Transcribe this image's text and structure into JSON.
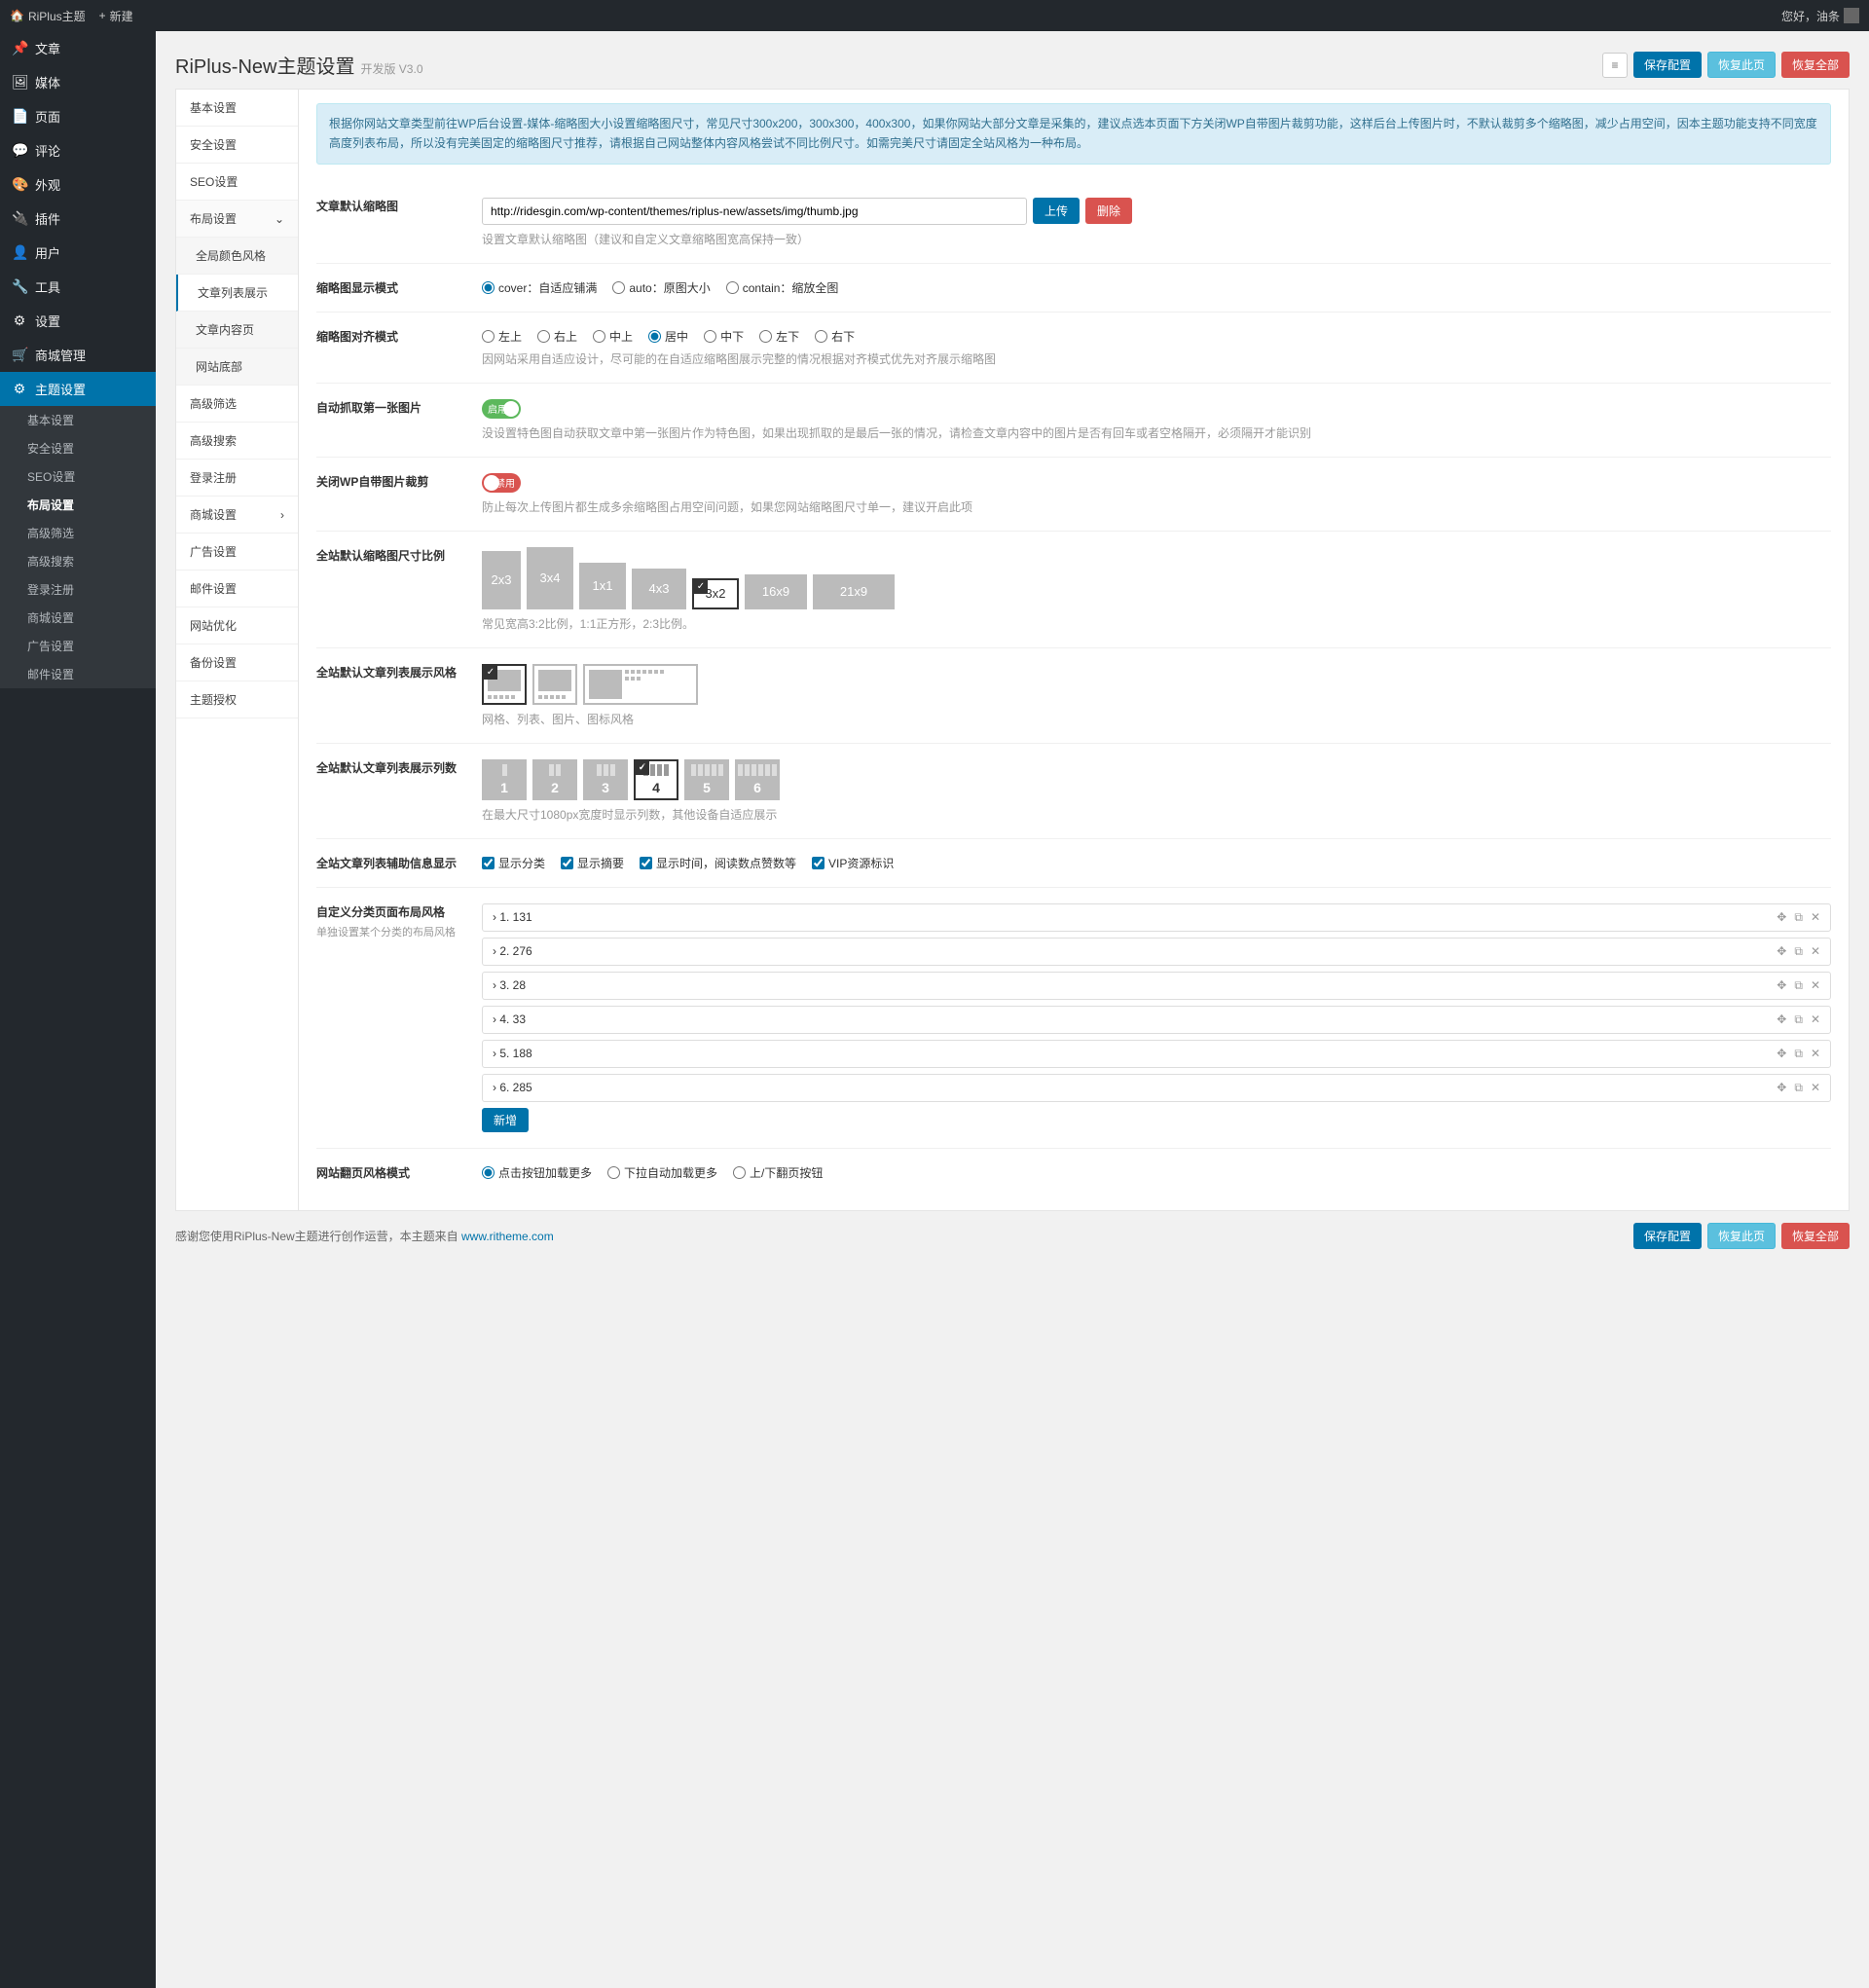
{
  "adminbar": {
    "site": "RiPlus主题",
    "new": "新建",
    "greeting": "您好，油条"
  },
  "sidebar": {
    "items": [
      {
        "icon": "📌",
        "label": "文章"
      },
      {
        "icon": "🖼",
        "label": "媒体"
      },
      {
        "icon": "📄",
        "label": "页面"
      },
      {
        "icon": "💬",
        "label": "评论"
      },
      {
        "icon": "🎨",
        "label": "外观"
      },
      {
        "icon": "🔌",
        "label": "插件"
      },
      {
        "icon": "👤",
        "label": "用户"
      },
      {
        "icon": "🔧",
        "label": "工具"
      },
      {
        "icon": "⚙",
        "label": "设置"
      },
      {
        "icon": "🛒",
        "label": "商城管理"
      },
      {
        "icon": "⚙",
        "label": "主题设置",
        "active": true
      }
    ],
    "sub": [
      "基本设置",
      "安全设置",
      "SEO设置",
      "布局设置",
      "高级筛选",
      "高级搜索",
      "登录注册",
      "商城设置",
      "广告设置",
      "邮件设置"
    ]
  },
  "panel": {
    "title": "RiPlus-New主题设置",
    "version": "开发版 V3.0",
    "save": "保存配置",
    "restore": "恢复此页",
    "restore_all": "恢复全部"
  },
  "tabs": {
    "list": [
      "基本设置",
      "安全设置",
      "SEO设置",
      "布局设置",
      "高级筛选",
      "高级搜索",
      "登录注册",
      "商城设置",
      "广告设置",
      "邮件设置",
      "网站优化",
      "备份设置",
      "主题授权"
    ],
    "layout_sub": [
      "全局颜色风格",
      "文章列表展示",
      "文章内容页",
      "网站底部"
    ]
  },
  "form": {
    "notice": "根据你网站文章类型前往WP后台设置-媒体-缩略图大小设置缩略图尺寸，常见尺寸300x200，300x300，400x300，如果你网站大部分文章是采集的，建议点选本页面下方关闭WP自带图片裁剪功能，这样后台上传图片时，不默认裁剪多个缩略图，减少占用空间，因本主题功能支持不同宽度高度列表布局，所以没有完美固定的缩略图尺寸推荐，请根据自己网站整体内容风格尝试不同比例尺寸。如需完美尺寸请固定全站风格为一种布局。",
    "thumb": {
      "label": "文章默认缩略图",
      "value": "http://ridesgin.com/wp-content/themes/riplus-new/assets/img/thumb.jpg",
      "upload": "上传",
      "delete": "删除",
      "desc": "设置文章默认缩略图（建议和自定义文章缩略图宽高保持一致）"
    },
    "display_mode": {
      "label": "缩略图显示模式",
      "options": [
        "cover：自适应铺满",
        "auto：原图大小",
        "contain：缩放全图"
      ]
    },
    "align_mode": {
      "label": "缩略图对齐模式",
      "options": [
        "左上",
        "右上",
        "中上",
        "居中",
        "中下",
        "左下",
        "右下"
      ],
      "desc": "因网站采用自适应设计，尽可能的在自适应缩略图展示完整的情况根据对齐模式优先对齐展示缩略图"
    },
    "auto_grab": {
      "label": "自动抓取第一张图片",
      "on_text": "启用",
      "desc": "没设置特色图自动获取文章中第一张图片作为特色图，如果出现抓取的是最后一张的情况，请检查文章内容中的图片是否有回车或者空格隔开，必须隔开才能识别"
    },
    "disable_crop": {
      "label": "关闭WP自带图片裁剪",
      "off_text": "禁用",
      "desc": "防止每次上传图片都生成多余缩略图占用空间问题，如果您网站缩略图尺寸单一，建议开启此项"
    },
    "ratio": {
      "label": "全站默认缩略图尺寸比例",
      "options": [
        "2x3",
        "3x4",
        "1x1",
        "4x3",
        "3x2",
        "16x9",
        "21x9"
      ],
      "desc": "常见宽高3:2比例，1:1正方形，2:3比例。"
    },
    "list_style": {
      "label": "全站默认文章列表展示风格",
      "desc": "网格、列表、图片、图标风格"
    },
    "cols": {
      "label": "全站默认文章列表展示列数",
      "options": [
        "1",
        "2",
        "3",
        "4",
        "5",
        "6"
      ],
      "desc": "在最大尺寸1080px宽度时显示列数，其他设备自适应展示"
    },
    "meta": {
      "label": "全站文章列表辅助信息显示",
      "options": [
        "显示分类",
        "显示摘要",
        "显示时间，阅读数点赞数等",
        "VIP资源标识"
      ]
    },
    "cat_layout": {
      "label": "自定义分类页面布局风格",
      "sub": "单独设置某个分类的布局风格",
      "items": [
        "1. 131",
        "2. 276",
        "3. 28",
        "4. 33",
        "5. 188",
        "6. 285"
      ],
      "add": "新增"
    },
    "pager": {
      "label": "网站翻页风格模式",
      "options": [
        "点击按钮加载更多",
        "下拉自动加载更多",
        "上/下翻页按钮"
      ]
    }
  },
  "footer": {
    "text": "感谢您使用RiPlus-New主题进行创作运营，本主题来自 ",
    "link": "www.ritheme.com"
  }
}
